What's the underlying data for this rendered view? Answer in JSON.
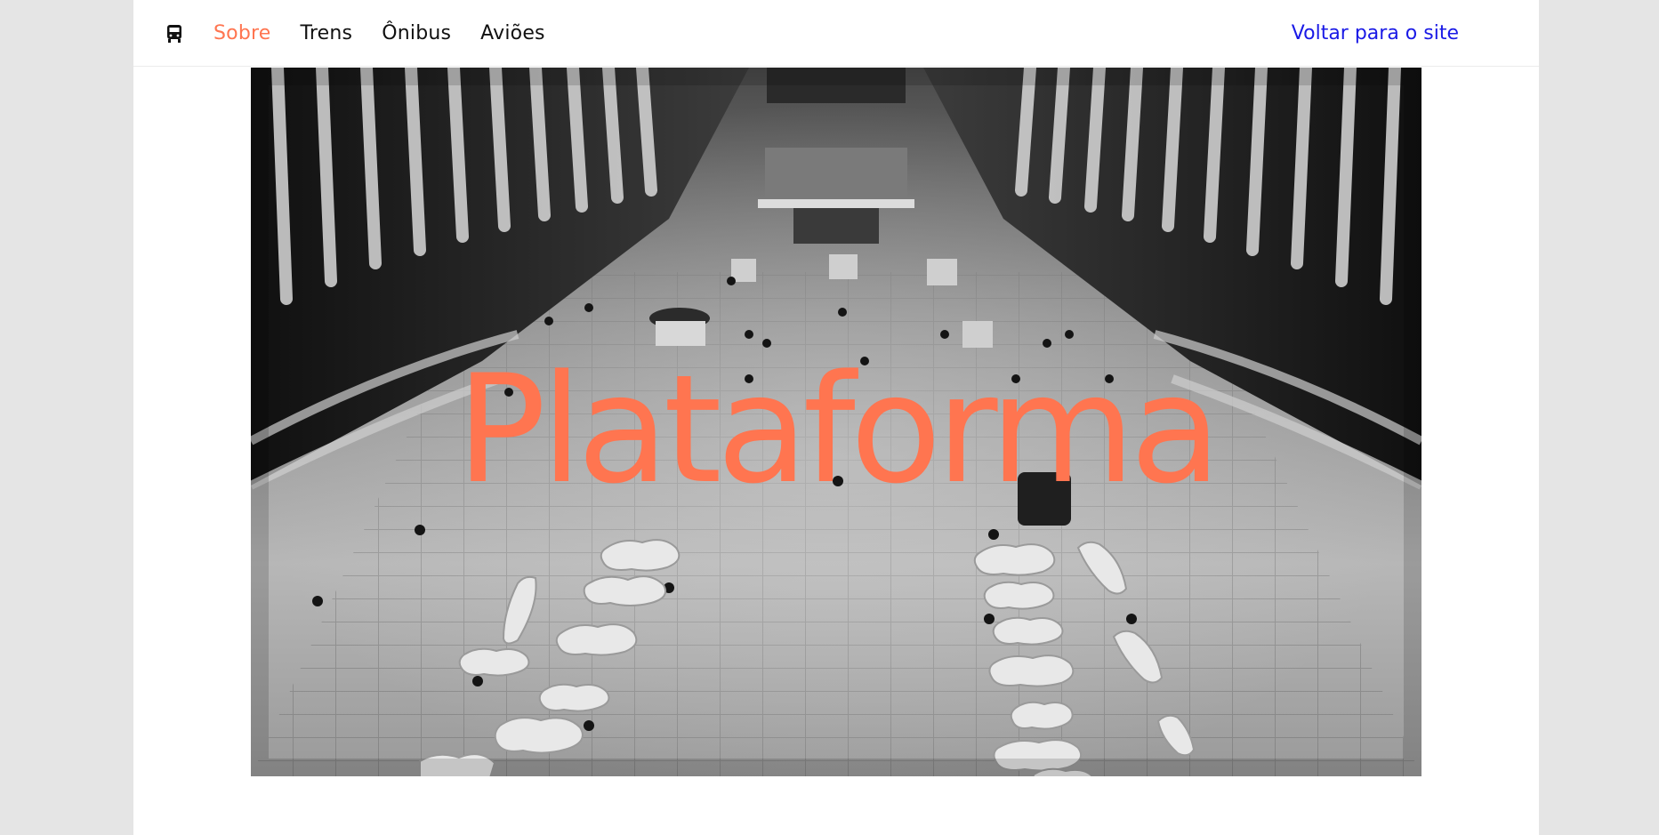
{
  "nav": {
    "logo_icon": "bus-icon",
    "links": [
      {
        "label": "Sobre",
        "active": true
      },
      {
        "label": "Trens",
        "active": false
      },
      {
        "label": "Ônibus",
        "active": false
      },
      {
        "label": "Aviões",
        "active": false
      }
    ],
    "back_link": "Voltar para o site"
  },
  "hero": {
    "title": "Plataforma",
    "image": "grayscale photo of a large transit hall interior with ribbed white structure, tiled floor, benches and people"
  },
  "colors": {
    "accent": "#ff7550",
    "link": "#1a1ae6",
    "text": "#111111",
    "background": "#e5e5e5"
  }
}
